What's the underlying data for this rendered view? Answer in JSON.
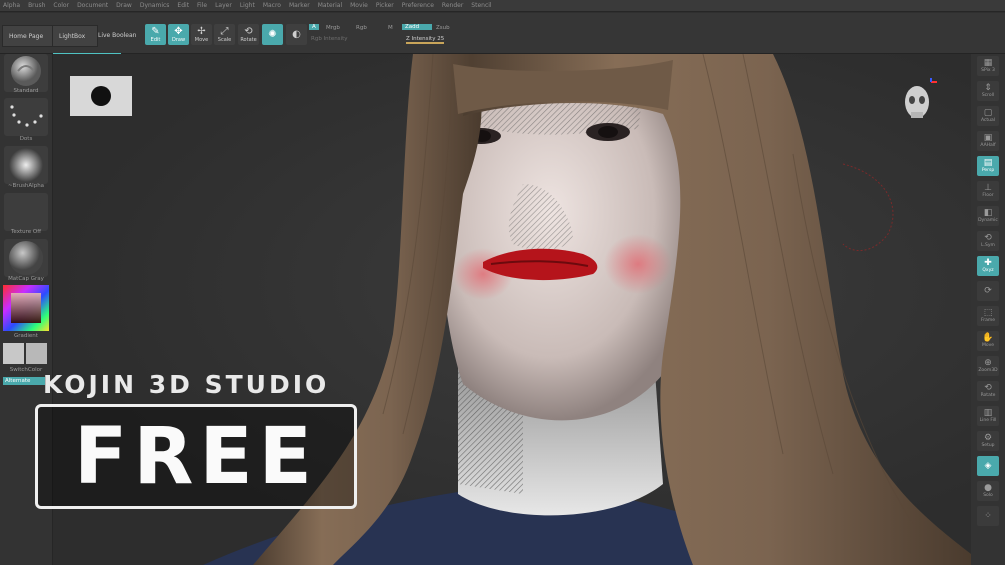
{
  "menu": [
    "Alpha",
    "Brush",
    "Color",
    "Document",
    "Draw",
    "Dynamics",
    "Edit",
    "File",
    "Layer",
    "Light",
    "Macro",
    "Marker",
    "Material",
    "Movie",
    "Picker",
    "Preference",
    "Render",
    "Stencil"
  ],
  "nav": {
    "home": "Home Page",
    "lightbox": "LightBox",
    "live_boolean": "Live Boolean"
  },
  "tools": [
    {
      "name": "edit",
      "label": "Edit",
      "icon": "✎",
      "on": true
    },
    {
      "name": "draw",
      "label": "Draw",
      "icon": "✥",
      "on": true
    },
    {
      "name": "move",
      "label": "Move",
      "icon": "✢",
      "on": false
    },
    {
      "name": "scale",
      "label": "Scale",
      "icon": "⤢",
      "on": false
    },
    {
      "name": "rotate",
      "label": "Rotate",
      "icon": "⟲",
      "on": false
    }
  ],
  "brush_params": {
    "a": "A",
    "mrgb": "Mrgb",
    "rgb": "Rgb",
    "m": "M",
    "zadd": "Zadd",
    "zsub": "Zsub",
    "rgb_intensity": "Rgb Intensity",
    "z_intensity": "Z Intensity 25"
  },
  "left_shelf": [
    {
      "name": "standard",
      "label": "Standard"
    },
    {
      "name": "dots",
      "label": "Dots"
    },
    {
      "name": "brush-alpha",
      "label": "~BrushAlpha"
    },
    {
      "name": "texture-off",
      "label": "Texture Off"
    },
    {
      "name": "matcap-gray",
      "label": "MatCap Gray"
    }
  ],
  "gradient_label": "Gradient",
  "switch_label": "SwitchColor",
  "alternate_label": "Alternate",
  "right_shelf": [
    {
      "name": "spix",
      "label": "SPix 3",
      "icon": "▦",
      "on": false
    },
    {
      "name": "scroll",
      "label": "Scroll",
      "icon": "⇕",
      "on": false
    },
    {
      "name": "actual",
      "label": "Actual",
      "icon": "▢",
      "on": false
    },
    {
      "name": "aahalf",
      "label": "AAHalf",
      "icon": "▣",
      "on": false
    },
    {
      "name": "persp",
      "label": "Persp",
      "icon": "▤",
      "on": true
    },
    {
      "name": "floor",
      "label": "Floor",
      "icon": "⊥",
      "on": false
    },
    {
      "name": "dynamic",
      "label": "Dynamic",
      "icon": "◧",
      "on": false
    },
    {
      "name": "local",
      "label": "L.Sym",
      "icon": "⟲",
      "on": false
    },
    {
      "name": "xyz",
      "label": "Qxyz",
      "icon": "✚",
      "on": true
    },
    {
      "name": "rot1",
      "label": "",
      "icon": "⟳",
      "on": false
    },
    {
      "name": "frame",
      "label": "Frame",
      "icon": "⬚",
      "on": false
    },
    {
      "name": "move",
      "label": "Move",
      "icon": "✋",
      "on": false
    },
    {
      "name": "zoom3d",
      "label": "Zoom3D",
      "icon": "⊕",
      "on": false
    },
    {
      "name": "rotate",
      "label": "Rotate",
      "icon": "⟲",
      "on": false
    },
    {
      "name": "linefill",
      "label": "Line Fill",
      "icon": "▥",
      "on": false
    },
    {
      "name": "setup",
      "label": "Setup",
      "icon": "⚙",
      "on": false
    },
    {
      "name": "transp",
      "label": "",
      "icon": "◈",
      "on": true
    },
    {
      "name": "solo",
      "label": "Solo",
      "icon": "●",
      "on": false
    },
    {
      "name": "xpose",
      "label": "",
      "icon": "⁘",
      "on": false
    }
  ],
  "overlay": {
    "studio": "KOJIN 3D STUDIO",
    "free": "FREE"
  },
  "colors": {
    "accent": "#4aa9ac",
    "hair": "#7a6450",
    "skin": "#ddd0cc",
    "lips": "#b5141b",
    "shirt": "#283352"
  }
}
